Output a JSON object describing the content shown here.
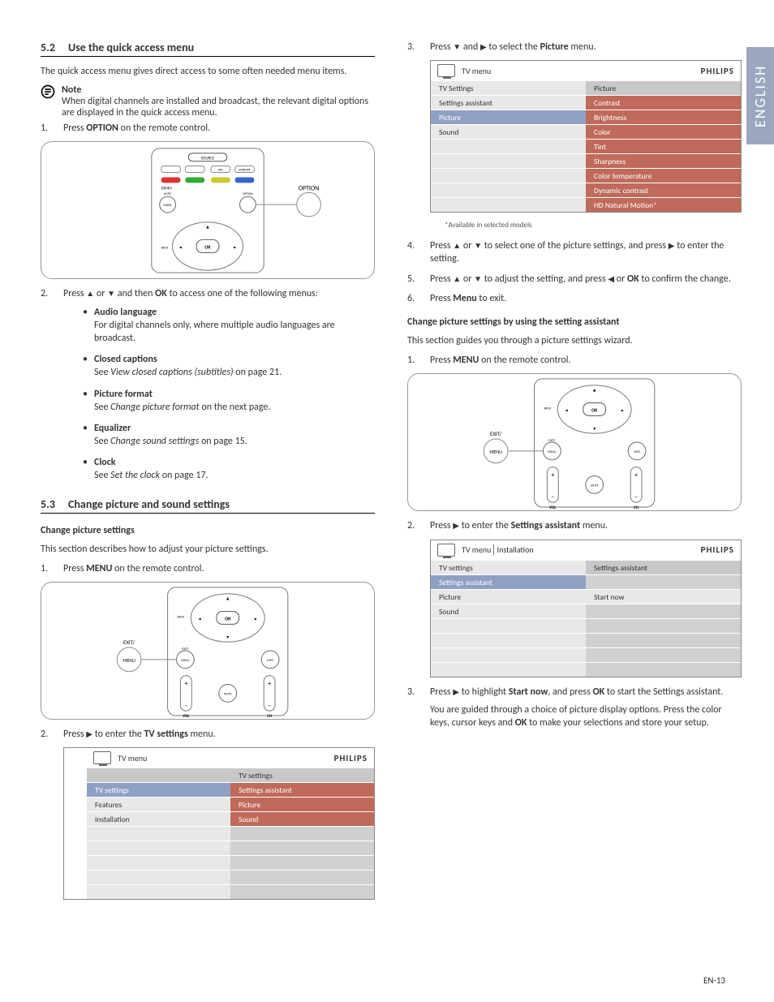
{
  "lang_tab": "ENGLISH",
  "page_number": "EN-13",
  "sec52": {
    "heading_num": "5.2",
    "heading": "Use the quick access menu",
    "intro": "The quick access menu gives direct access to some often needed menu items.",
    "note_label": "Note",
    "note_body": "When digital channels are installed and broadcast, the relevant digital options are displayed in the quick access menu.",
    "step1_pre": "Press ",
    "step1_bold": "OPTION",
    "step1_post": " on the remote control.",
    "step2_pre": "Press ",
    "step2_mid": " or ",
    "step2_mid2": " and then ",
    "step2_bold": "OK",
    "step2_post": " to access one of the following menus:",
    "submenu": [
      {
        "title": "Audio language",
        "body_pre": "For digital channels only, where multiple audio languages are broadcast.",
        "ref": "",
        "body_post": ""
      },
      {
        "title": "Closed captions",
        "body_pre": "See ",
        "ref": "View closed captions (subtitles)",
        "body_post": " on page 21."
      },
      {
        "title": "Picture format",
        "body_pre": "See ",
        "ref": "Change picture format",
        "body_post": " on the next page."
      },
      {
        "title": "Equalizer",
        "body_pre": "See ",
        "ref": "Change sound settings",
        "body_post": " on page 15."
      },
      {
        "title": "Clock",
        "body_pre": "See ",
        "ref": "Set the clock",
        "body_post": " on page 17."
      }
    ]
  },
  "sec53": {
    "heading_num": "5.3",
    "heading": "Change picture and sound settings",
    "sub1": "Change picture settings",
    "sub1_intro": "This section describes how to adjust your picture settings.",
    "s1_step1_pre": "Press ",
    "s1_step1_bold": "MENU",
    "s1_step1_post": " on the remote control.",
    "s1_step2_pre": "Press ",
    "s1_step2_mid": " to enter the ",
    "s1_step2_bold": "TV settings",
    "s1_step2_post": " menu.",
    "s1_step3_pre": "Press ",
    "s1_step3_mid": " and ",
    "s1_step3_mid2": " to select the ",
    "s1_step3_bold": "Picture",
    "s1_step3_post": " menu.",
    "s1_step4_pre": "Press ",
    "s1_step4_mid": " or ",
    "s1_step4_mid2": " to select one of the picture settings, and press ",
    "s1_step4_post": " to enter the setting.",
    "s1_step5_pre": "Press ",
    "s1_step5_mid": " or ",
    "s1_step5_mid2": " to adjust the setting, and press ",
    "s1_step5_mid3": " or ",
    "s1_step5_bold": "OK",
    "s1_step5_post": " to confirm the change.",
    "s1_step6_pre": "Press ",
    "s1_step6_bold": "Menu",
    "s1_step6_post": " to exit.",
    "sub2": "Change picture settings by using the setting assistant",
    "sub2_intro": "This section guides you through a picture settings wizard.",
    "s2_step1_pre": "Press ",
    "s2_step1_bold": "MENU",
    "s2_step1_post": " on the remote control.",
    "s2_step2_pre": "Press ",
    "s2_step2_mid": " to enter the ",
    "s2_step2_bold": "Settings assistant",
    "s2_step2_post": " menu.",
    "s2_step3_pre": "Press ",
    "s2_step3_mid": " to highlight ",
    "s2_step3_bold": "Start now",
    "s2_step3_mid2": ", and press ",
    "s2_step3_bold2": "OK",
    "s2_step3_post": " to start the Settings assistant.",
    "s2_tail_pre": "You are guided through a choice of picture display options.  Press the color keys, cursor keys and ",
    "s2_tail_bold": "OK",
    "s2_tail_post": " to make your selections and store your setup."
  },
  "osd1": {
    "brand": "PHILIPS",
    "crumb": "TV menu",
    "left_head": "",
    "left": [
      "TV settings",
      "Features",
      "Installation"
    ],
    "right_head": "TV settings",
    "right": [
      "Settings assistant",
      "Picture",
      "Sound"
    ]
  },
  "osd2": {
    "brand": "PHILIPS",
    "crumb": "TV menu",
    "left_head": "",
    "left": [
      "TV Settings",
      "Settings assistant",
      "Picture",
      "Sound"
    ],
    "right_head": "Picture",
    "right": [
      "Contrast",
      "Brightness",
      "Color",
      "Tint",
      "Sharpness",
      "Color temperature",
      "Dynamic contrast",
      "HD Natural Motion*"
    ],
    "footnote": "*Available in selected models"
  },
  "osd3": {
    "brand": "PHILIPS",
    "crumb1": "TV menu",
    "crumb2": "Installation",
    "left": [
      "TV settings",
      "Settings assistant",
      "Picture",
      "Sound"
    ],
    "right_head": "Settings assistant",
    "right": [
      "",
      "Start now"
    ]
  },
  "remote1": {
    "labels": {
      "source": "SOURCE",
      "fav": "FAV",
      "format": "FORMAT",
      "demo": "DEMO",
      "auto": "AUTO",
      "mode": "MODE",
      "option_btn": "OPTION",
      "option_callout": "OPTION",
      "back": "BACK",
      "ok": "OK"
    }
  },
  "remote2": {
    "labels": {
      "back": "BACK",
      "ok": "OK",
      "exit": "EXIT/",
      "menu": "MENU",
      "info": "INFO",
      "vol": "VOL",
      "mute": "MUTE",
      "ch": "CH"
    }
  }
}
